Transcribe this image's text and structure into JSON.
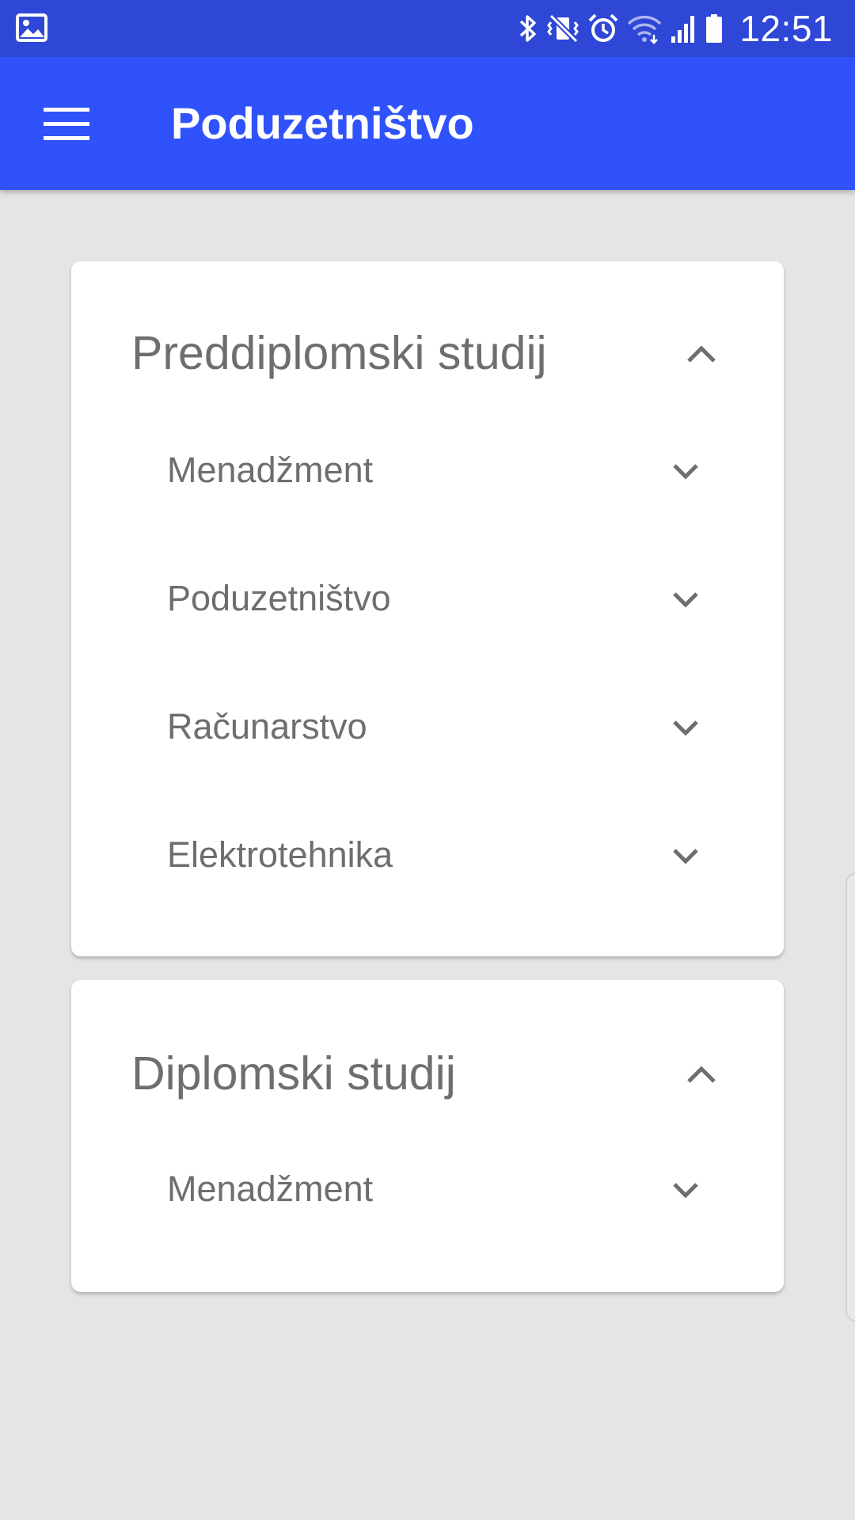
{
  "status_bar": {
    "time": "12:51",
    "icons": [
      "image-icon",
      "bluetooth-icon",
      "vibrate-mute-icon",
      "alarm-icon",
      "wifi-icon",
      "signal-icon",
      "battery-icon"
    ]
  },
  "app_bar": {
    "title": "Poduzetništvo",
    "menu_icon": "hamburger-menu-icon"
  },
  "colors": {
    "status_bar": "#2e47d6",
    "app_bar": "#2f52fb",
    "background": "#e5e5e5",
    "card": "#ffffff",
    "text": "#6e6e6e"
  },
  "sections": [
    {
      "title": "Preddiplomski studij",
      "expanded": true,
      "items": [
        {
          "label": "Menadžment"
        },
        {
          "label": "Poduzetništvo"
        },
        {
          "label": "Računarstvo"
        },
        {
          "label": "Elektrotehnika"
        }
      ]
    },
    {
      "title": "Diplomski studij",
      "expanded": true,
      "items": [
        {
          "label": "Menadžment"
        }
      ]
    }
  ]
}
